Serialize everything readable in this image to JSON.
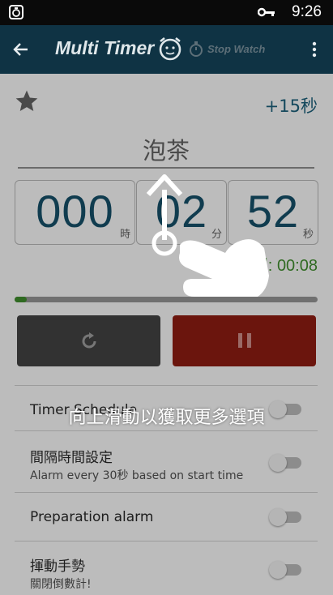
{
  "status_bar": {
    "time": "9:26"
  },
  "app_bar": {
    "title": "Multi Timer",
    "stopwatch_label": "Stop Watch"
  },
  "timer": {
    "plus_button": "+15秒",
    "name": "泡茶",
    "hours": "000",
    "hours_unit": "時",
    "minutes": "02",
    "minutes_unit": "分",
    "seconds": "52",
    "seconds_unit": "秒",
    "elapsed_prefix": "經過時間:",
    "elapsed": "00:08",
    "progress": 0.04
  },
  "settings": [
    {
      "label": "Timer Schedule",
      "sublabel": ""
    },
    {
      "label": "間隔時間設定",
      "sublabel": "Alarm every 30秒 based on start time"
    },
    {
      "label": "Preparation alarm",
      "sublabel": ""
    },
    {
      "label": "揮動手勢",
      "sublabel": "關閉倒數計!"
    }
  ],
  "overlay": {
    "hint": "向上滑動以獲取更多選項"
  },
  "icons": [
    "app-notification-icon",
    "key-icon",
    "back-arrow-icon",
    "alarm-clock-icon",
    "stopwatch-icon",
    "more-vert-icon",
    "star-icon",
    "reset-icon",
    "pause-icon",
    "swipe-up-arrow-icon",
    "hand-pointer-icon"
  ],
  "colors": {
    "app_bar": "#0f3344",
    "accent_green": "#2f6a21",
    "pause_red": "#6b150d"
  }
}
